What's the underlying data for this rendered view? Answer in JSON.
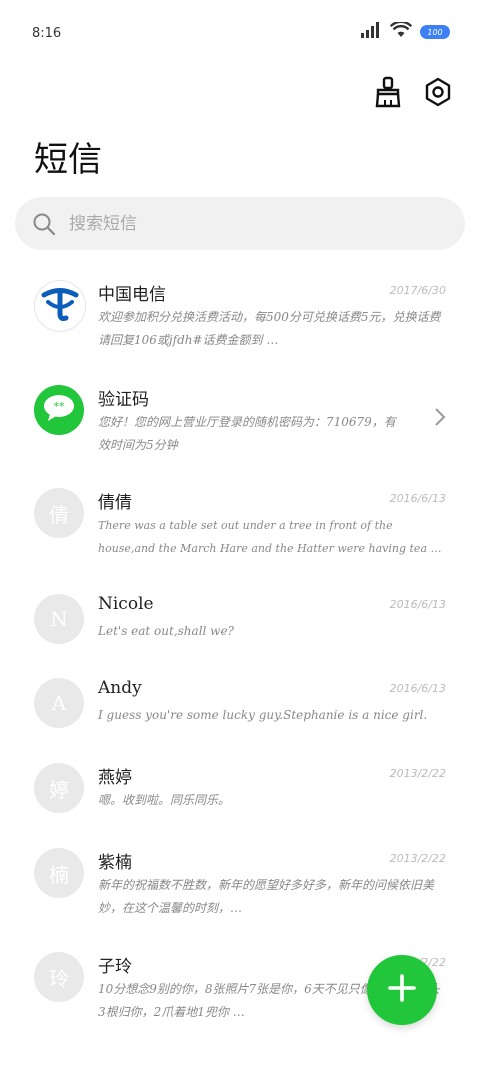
{
  "status": {
    "time": "8:16",
    "battery": "100"
  },
  "header": {
    "title": "短信",
    "clean_icon": "broom-icon",
    "settings_icon": "gear-icon"
  },
  "search": {
    "placeholder": "搜索短信"
  },
  "messages": [
    {
      "name": "中国电信",
      "date": "2017/6/30",
      "preview": "欢迎参加积分兑换活费活动，每500分可兑换话费5元，兑换话费请回复106或jfdh#话费金额到 …",
      "avatar_text": ""
    },
    {
      "name": "验证码",
      "date": "",
      "preview": "您好！您的网上营业厅登录的随机密码为：710679，有效时间为5分钟",
      "avatar_text": "**"
    },
    {
      "name": "倩倩",
      "date": "2016/6/13",
      "preview": "There was a table set out under a tree in front of the house,and the March Hare and the Hatter were having tea …",
      "avatar_text": "倩"
    },
    {
      "name": "Nicole",
      "date": "2016/6/13",
      "preview": "Let's eat out,shall we?",
      "avatar_text": "N"
    },
    {
      "name": "Andy",
      "date": "2016/6/13",
      "preview": "I guess you're some lucky guy.Stephanie is a nice girl.",
      "avatar_text": "A"
    },
    {
      "name": "燕婷",
      "date": "2013/2/22",
      "preview": "嗯。收到啦。同乐同乐。",
      "avatar_text": "婷"
    },
    {
      "name": "紫楠",
      "date": "2013/2/22",
      "preview": "新年的祝福数不胜数，新年的愿望好多好多，新年的问候依旧美妙，在这个温馨的时刻，…",
      "avatar_text": "楠"
    },
    {
      "name": "子玲",
      "date": "2013/2/22",
      "preview": "10分想念9别的你，8张照片7张是你，6天不见只像你，4根骨头3根归你，2爪着地1兜你 …",
      "avatar_text": "玲"
    }
  ],
  "colors": {
    "accent_green": "#22c63a",
    "telecom_blue": "#0a5db8"
  }
}
